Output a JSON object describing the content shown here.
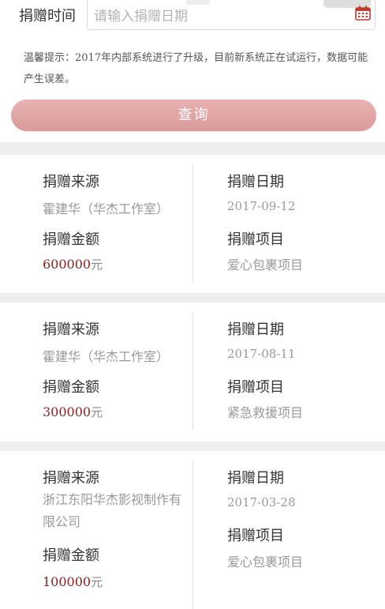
{
  "filter": {
    "date_label": "捐赠时间",
    "date_placeholder": "请输入捐赠日期",
    "notice": "温馨提示：2017年内部系统进行了升级，目前新系统正在试运行，数据可能产生误差。",
    "query_button": "查询",
    "calendar_icon": "calendar-icon"
  },
  "labels": {
    "source": "捐赠来源",
    "date": "捐赠日期",
    "amount": "捐赠金额",
    "project": "捐赠项目",
    "currency_unit": "元"
  },
  "records": [
    {
      "source": "霍建华（华杰工作室）",
      "date": "2017-09-12",
      "amount": "600000",
      "project": "爱心包裹项目"
    },
    {
      "source": "霍建华（华杰工作室）",
      "date": "2017-08-11",
      "amount": "300000",
      "project": "紧急救援项目"
    },
    {
      "source": "浙江东阳华杰影视制作有限公司",
      "date": "2017-03-28",
      "amount": "100000",
      "project": "爱心包裹项目"
    }
  ],
  "colors": {
    "accent_button": "#e1a6a6",
    "amount_text": "#8a2323",
    "calendar_icon": "#c0392b"
  }
}
